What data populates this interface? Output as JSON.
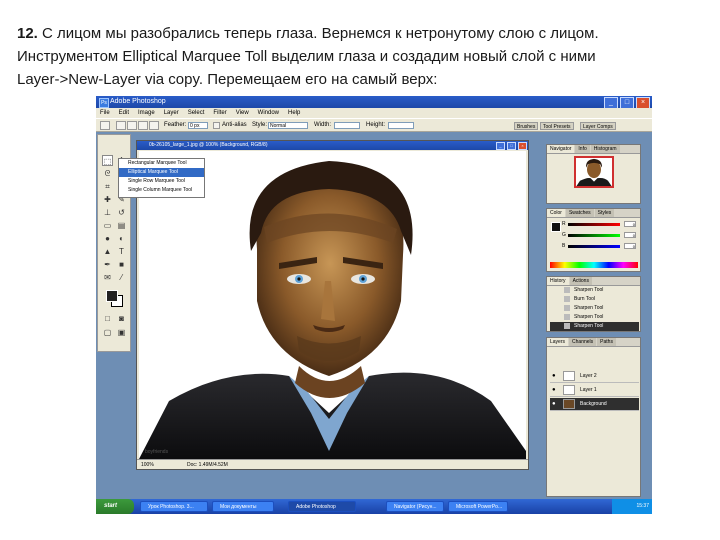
{
  "caption": {
    "step": "12.",
    "line1": "С лицом мы разобрались теперь глаза. Вернемся к нетронутому слою с лицом.",
    "line2": "Инструментом Elliptical Marquee Toll выделим глаза и создадим новый слой с ними",
    "line3": "Layer->New-Layer via copy. Перемещаем его на самый верх:"
  },
  "window": {
    "title": "Adobe Photoshop"
  },
  "menu": [
    "File",
    "Edit",
    "Image",
    "Layer",
    "Select",
    "Filter",
    "View",
    "Window",
    "Help"
  ],
  "options": {
    "feather_label": "Feather:",
    "feather_value": "0 px",
    "antialias_label": "Anti-alias",
    "style_label": "Style:",
    "style_value": "Normal",
    "width_label": "Width:",
    "height_label": "Height:",
    "palettes": [
      "Brushes",
      "Tool Presets",
      "Layer Comps"
    ]
  },
  "document": {
    "title": "0b-26105_large_1.jpg @ 100% (Background, RGB/8)",
    "zoom": "100%",
    "doc_info": "Doc: 1.49M/4.52M",
    "credit": "boyfriends"
  },
  "marquee_flyout": [
    "Rectangular Marquee Tool",
    "Elliptical Marquee Tool",
    "Single Row Marquee Tool",
    "Single Column Marquee Tool"
  ],
  "navigator": {
    "tabs": [
      "Navigator",
      "Info",
      "Histogram"
    ]
  },
  "color_panel": {
    "tabs": [
      "Color",
      "Swatches",
      "Styles"
    ],
    "channels": [
      {
        "label": "R",
        "value": "0"
      },
      {
        "label": "G",
        "value": "0"
      },
      {
        "label": "B",
        "value": "0"
      }
    ]
  },
  "history": {
    "tabs": [
      "History",
      "Actions"
    ],
    "items": [
      "Sharpen Tool",
      "Burn Tool",
      "Sharpen Tool",
      "Sharpen Tool",
      "Sharpen Tool"
    ]
  },
  "layers": {
    "tabs": [
      "Layers",
      "Channels",
      "Paths"
    ],
    "items": [
      "Layer 2",
      "Layer 1",
      "Background"
    ]
  },
  "taskbar": {
    "start": "start",
    "tasks": [
      "Урок Photoshop. 3...",
      "Мои документы",
      "Adobe Photoshop",
      "Navigator (Рисун...",
      "Microsoft PowerPo..."
    ],
    "clock": "15:37"
  },
  "colors": {
    "titlebar": "#1d48a8",
    "workspace": "#6e8eb4",
    "chrome": "#ece9d8"
  }
}
